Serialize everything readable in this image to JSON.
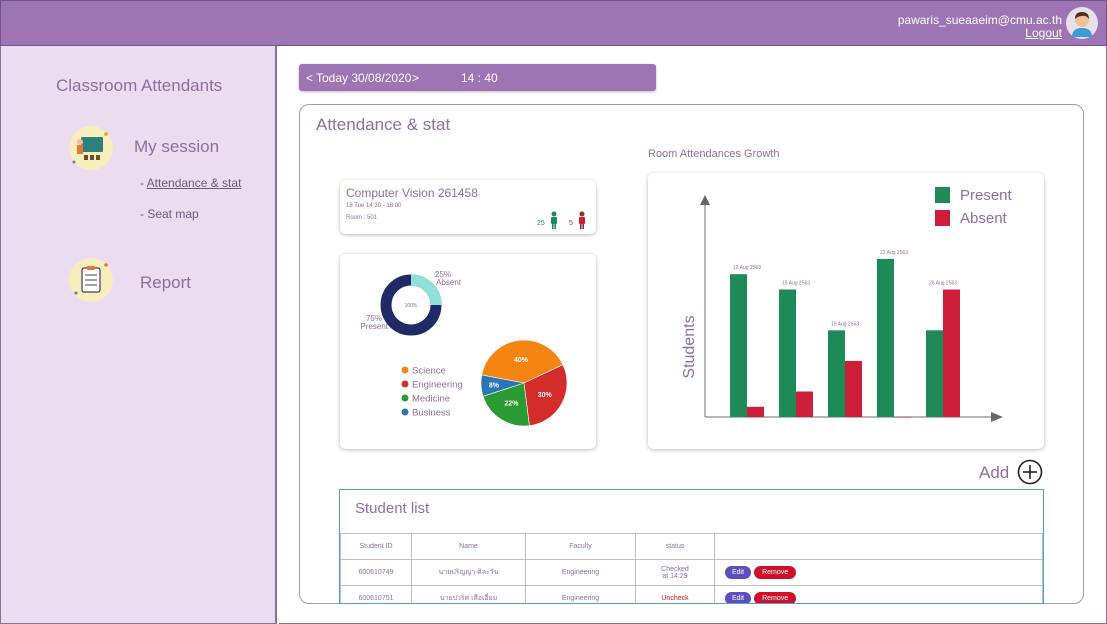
{
  "header": {
    "email": "pawaris_sueaaeim@cmu.ac.th",
    "logout_label": "Logout"
  },
  "sidebar": {
    "title": "Classroom Attendants",
    "sections": [
      {
        "label": "My session",
        "icon": "teacher-board-icon"
      },
      {
        "label": "Report",
        "icon": "report-clipboard-icon"
      }
    ],
    "links": [
      {
        "label": "- ",
        "link_text": "Attendance & stat"
      },
      {
        "label": "- Seat map"
      }
    ]
  },
  "datebar": {
    "prev": "<",
    "date": "Today 30/08/2020",
    "next": ">",
    "time": "14 : 40"
  },
  "panel": {
    "title": "Attendance & stat"
  },
  "course_card": {
    "name": "Computer Vision 261458",
    "time": "18 Tue   14:30 - 18:00",
    "room": "Room : 501",
    "present_count": "25",
    "absent_count": "5"
  },
  "donut": {
    "center": "100%",
    "absent_pct": "25%",
    "absent_label": "Absent",
    "present_pct": "75%",
    "present_label": "Present"
  },
  "chart_data": [
    {
      "type": "pie",
      "labels": [
        "Science",
        "Engineering",
        "Medicine",
        "Business"
      ],
      "values": [
        40,
        30,
        22,
        8
      ],
      "value_labels": [
        "40%",
        "30%",
        "22%",
        "8%"
      ],
      "colors": [
        "#f58512",
        "#d42b2b",
        "#2a9b32",
        "#2a75b3"
      ]
    },
    {
      "type": "bar",
      "title": "Room Attendances Growth",
      "ylabel": "Students",
      "categories": [
        "12 Aug 2563",
        "15 Aug 2563",
        "19 Aug 2563",
        "22 Aug 2563",
        "26 Aug 2563"
      ],
      "series": [
        {
          "name": "Present",
          "color": "#1e8a57",
          "values": [
            28,
            25,
            17,
            31,
            17
          ]
        },
        {
          "name": "Absent",
          "color": "#cd1e3c",
          "values": [
            2,
            5,
            11,
            0,
            25
          ]
        }
      ],
      "ylim": [
        0,
        40
      ]
    }
  ],
  "add": {
    "label": "Add"
  },
  "student_list": {
    "title": "Student list",
    "columns": [
      "Student ID",
      "Name",
      "Faculty",
      "status"
    ],
    "rows": [
      {
        "id": "600610749",
        "name": "นายปริญญา ศิละวัน",
        "faculty": "Engineering",
        "status": "Checked at 14:29",
        "status_line1": "Checked",
        "status_line2": "at 14:29"
      },
      {
        "id": "600610751",
        "name": "นายปวริศ เสือเอี่ยม",
        "faculty": "Engineering",
        "status": "Uncheck"
      }
    ],
    "edit_label": "Edit",
    "remove_label": "Remove"
  }
}
